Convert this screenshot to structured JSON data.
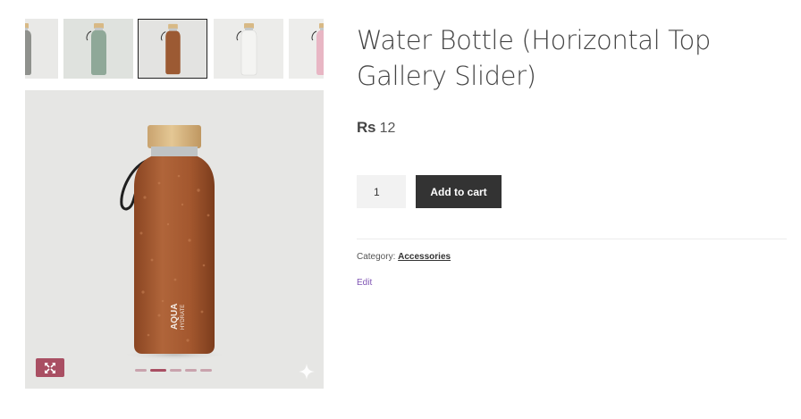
{
  "gallery": {
    "thumbnails": [
      {
        "name": "thumbnail-grey-bottle",
        "color": "#8f918d",
        "bg": "#e9e9e7"
      },
      {
        "name": "thumbnail-sage-bottle",
        "color": "#8fa898",
        "bg": "#dfe2de"
      },
      {
        "name": "thumbnail-brown-bottle",
        "color": "#9c5a33",
        "bg": "#e3e3e1"
      },
      {
        "name": "thumbnail-white-bottle",
        "color": "#f4f4f2",
        "bg": "#ececea"
      },
      {
        "name": "thumbnail-pink-bottle",
        "color": "#e8b6c4",
        "bg": "#ededeb"
      }
    ],
    "active_index": 2,
    "main_image": {
      "bottle_color": "#a3572e",
      "cap_color": "#d9b988",
      "brand_line1": "AQUA",
      "brand_line2": "HYDRATE"
    },
    "pagination": {
      "count": 5,
      "active": 1
    },
    "accent_color": "#a94f63"
  },
  "product": {
    "title": "Water Bottle (Horizontal Top Gallery Slider)",
    "price_currency": "Rs",
    "price_value": "12",
    "quantity": "1",
    "add_to_cart_label": "Add to cart",
    "category_label": "Category:",
    "category_value": "Accessories",
    "edit_label": "Edit"
  }
}
